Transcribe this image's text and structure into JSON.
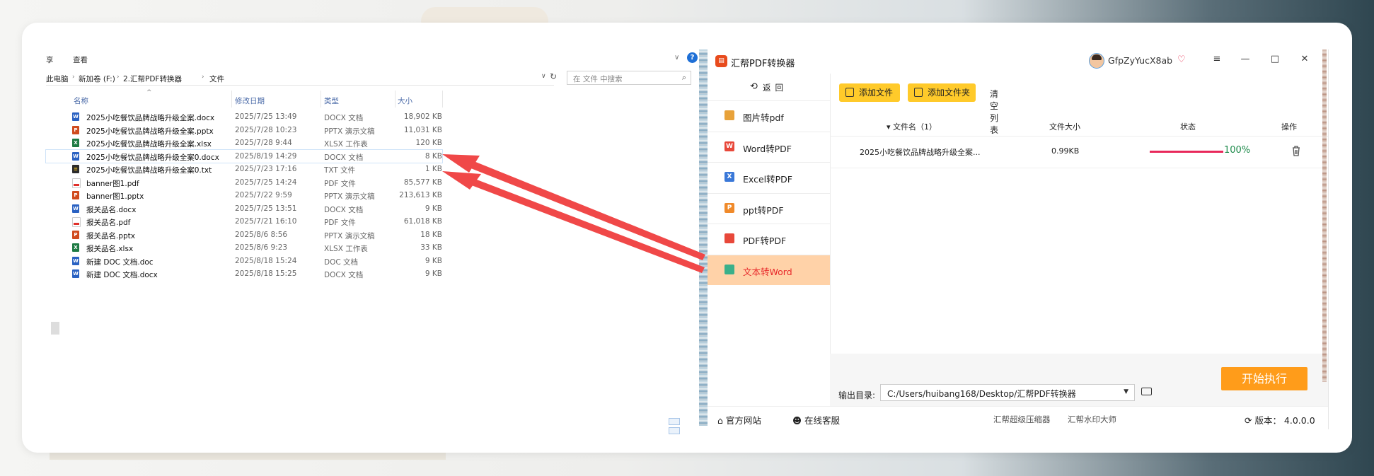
{
  "explorer": {
    "menu_partial": "享",
    "menu_view": "查看",
    "help": "?",
    "breadcrumb": [
      "此电脑",
      "新加卷 (F:)",
      "2.汇帮PDF转换器",
      "文件"
    ],
    "search_placeholder": "在 文件 中搜索",
    "columns": {
      "name": "名称",
      "date": "修改日期",
      "type": "类型",
      "size": "大小"
    },
    "files": [
      {
        "name": "2025小吃餐饮品牌战略升级全案.docx",
        "date": "2025/7/25 13:49",
        "type": "DOCX 文档",
        "size": "18,902 KB",
        "icon": "docx"
      },
      {
        "name": "2025小吃餐饮品牌战略升级全案.pptx",
        "date": "2025/7/28 10:23",
        "type": "PPTX 演示文稿",
        "size": "11,031 KB",
        "icon": "pptx"
      },
      {
        "name": "2025小吃餐饮品牌战略升级全案.xlsx",
        "date": "2025/7/28 9:44",
        "type": "XLSX 工作表",
        "size": "120 KB",
        "icon": "xlsx"
      },
      {
        "name": "2025小吃餐饮品牌战略升级全案0.docx",
        "date": "2025/8/19 14:29",
        "type": "DOCX 文档",
        "size": "8 KB",
        "icon": "docx",
        "selected": true
      },
      {
        "name": "2025小吃餐饮品牌战略升级全案0.txt",
        "date": "2025/7/23 17:16",
        "type": "TXT 文件",
        "size": "1 KB",
        "icon": "txt"
      },
      {
        "name": "banner图1.pdf",
        "date": "2025/7/25 14:24",
        "type": "PDF 文件",
        "size": "85,577 KB",
        "icon": "pdf"
      },
      {
        "name": "banner图1.pptx",
        "date": "2025/7/22 9:59",
        "type": "PPTX 演示文稿",
        "size": "213,613 KB",
        "icon": "pptx"
      },
      {
        "name": "报关品名.docx",
        "date": "2025/7/25 13:51",
        "type": "DOCX 文档",
        "size": "9 KB",
        "icon": "docx"
      },
      {
        "name": "报关品名.pdf",
        "date": "2025/7/21 16:10",
        "type": "PDF 文件",
        "size": "61,018 KB",
        "icon": "pdf"
      },
      {
        "name": "报关品名.pptx",
        "date": "2025/8/6 8:56",
        "type": "PPTX 演示文稿",
        "size": "18 KB",
        "icon": "pptx"
      },
      {
        "name": "报关品名.xlsx",
        "date": "2025/8/6 9:23",
        "type": "XLSX 工作表",
        "size": "33 KB",
        "icon": "xlsx"
      },
      {
        "name": "新建 DOC 文档.doc",
        "date": "2025/8/18 15:24",
        "type": "DOC 文档",
        "size": "9 KB",
        "icon": "docx"
      },
      {
        "name": "新建 DOC 文档.docx",
        "date": "2025/8/18 15:25",
        "type": "DOCX 文档",
        "size": "9 KB",
        "icon": "docx"
      }
    ]
  },
  "app": {
    "name": "汇帮PDF转换器",
    "username": "GfpZyYucX8ab",
    "back_label": "返回",
    "nav": [
      {
        "label": "图片转pdf",
        "icon": "image-icon",
        "color": "#e8a23a"
      },
      {
        "label": "Word转PDF",
        "icon": "word-icon",
        "color": "#e8483a",
        "glyph": "W"
      },
      {
        "label": "Excel转PDF",
        "icon": "excel-icon",
        "color": "#3a78d8",
        "glyph": "X"
      },
      {
        "label": "ppt转PDF",
        "icon": "ppt-icon",
        "color": "#f08a2a",
        "glyph": "P"
      },
      {
        "label": "PDF转PDF",
        "icon": "pdf-icon",
        "color": "#e8483a"
      },
      {
        "label": "文本转Word",
        "icon": "text-icon",
        "color": "#3ab08a",
        "active": true
      }
    ],
    "toolbar": {
      "add_file": "添加文件",
      "add_folder": "添加文件夹",
      "clear": "清空列表"
    },
    "table_headers": {
      "name": "▾ 文件名（1）",
      "size": "文件大小",
      "status": "状态",
      "action": "操作"
    },
    "file": {
      "name": "2025小吃餐饮品牌战略升级全案...",
      "size": "0.99KB",
      "progress": 100,
      "progress_label": "100%"
    },
    "output_label": "输出目录:",
    "output_path": "C:/Users/huibang168/Desktop/汇帮PDF转换器",
    "start_button": "开始执行",
    "footer": {
      "website": "官方网站",
      "support": "在线客服",
      "link1": "汇帮超级压缩器",
      "link2": "汇帮水印大师",
      "version": "版本： 4.0.0.0"
    },
    "accent_color": "#ffca2a",
    "start_color": "#ff9c1a"
  }
}
